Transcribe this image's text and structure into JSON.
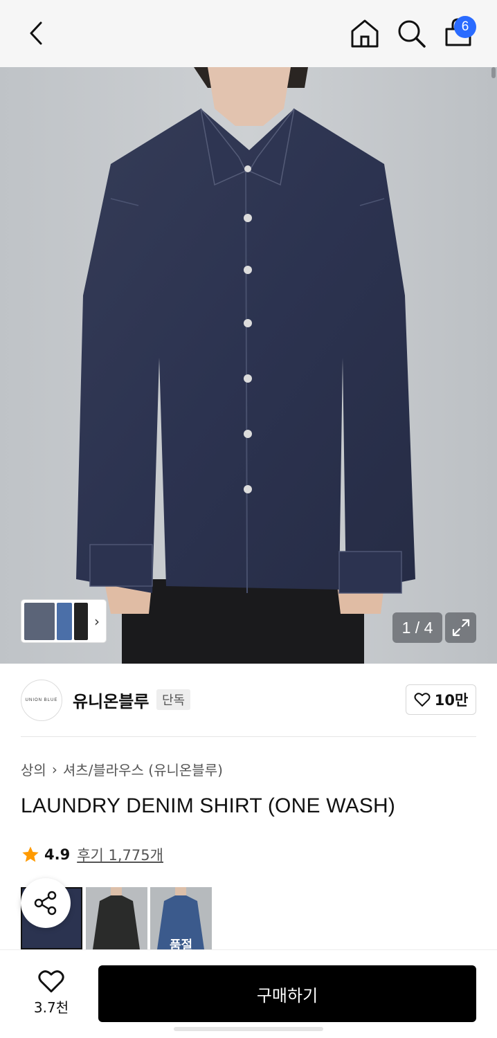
{
  "header": {
    "back_icon": "chevron-left-icon",
    "home_icon": "home-icon",
    "search_icon": "search-icon",
    "cart_icon": "shopping-bag-icon",
    "cart_count": "6"
  },
  "gallery": {
    "counter": "1 / 4",
    "expand_icon": "expand-icon"
  },
  "brand": {
    "logo_text": "UNION BLUE",
    "name": "유니온블루",
    "tag": "단독",
    "follow_count": "10만"
  },
  "product": {
    "breadcrumb": [
      "상의",
      "셔츠/블라우스 (유니온블루)"
    ],
    "title": "LAUNDRY DENIM SHIRT (ONE WASH)",
    "rating": "4.9",
    "reviews": "후기 1,775개",
    "variants": [
      {
        "color": "#2b3350",
        "selected": true,
        "badge": ""
      },
      {
        "color": "#2a2b2a",
        "selected": false,
        "badge": ""
      },
      {
        "color": "#3b5a8c",
        "selected": false,
        "badge": "품절"
      }
    ]
  },
  "bottom": {
    "like_count": "3.7천",
    "buy_label": "구매하기"
  },
  "colors": {
    "accent": "#2a6bff",
    "star": "#ff9a00",
    "denim": "#2f3652",
    "background": "#c4c8cc"
  }
}
